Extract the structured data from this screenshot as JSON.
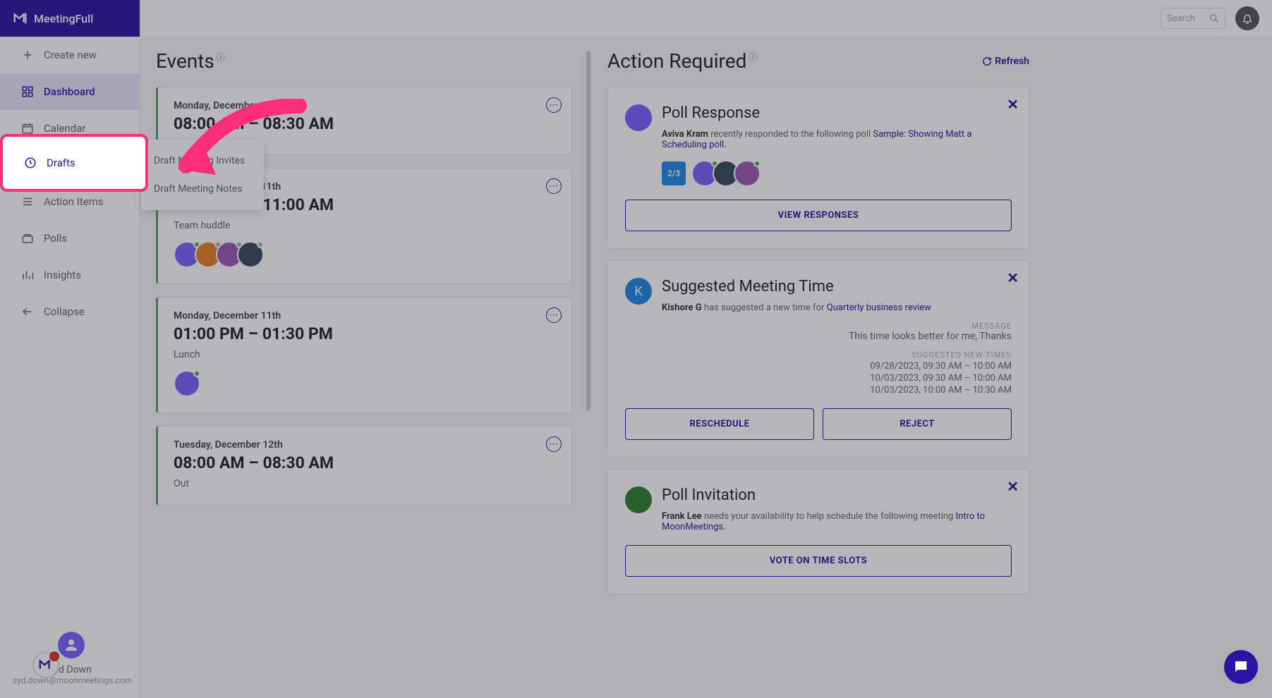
{
  "brand": "MeetingFull",
  "sidebar": {
    "items": [
      {
        "icon": "plus",
        "label": "Create new"
      },
      {
        "icon": "grid",
        "label": "Dashboard"
      },
      {
        "icon": "calendar",
        "label": "Calendar"
      },
      {
        "icon": "clock",
        "label": "Drafts"
      },
      {
        "icon": "list",
        "label": "Action Items"
      },
      {
        "icon": "poll",
        "label": "Polls"
      },
      {
        "icon": "bar",
        "label": "Insights"
      },
      {
        "icon": "arrow-left",
        "label": "Collapse"
      }
    ]
  },
  "user": {
    "name": "Syd Down",
    "email": "syd.down@moonmeetings.com"
  },
  "search_placeholder": "Search",
  "events": {
    "title": "Events",
    "items": [
      {
        "date": "Monday, December 11th",
        "time": "08:00 AM – 08:30 AM",
        "title": "",
        "avatars": []
      },
      {
        "date": "Monday, December 11th",
        "time": "10:30 AM – 11:00 AM",
        "title": "Team huddle",
        "avatars": [
          "a",
          "b",
          "c",
          "d"
        ]
      },
      {
        "date": "Monday, December 11th",
        "time": "01:00 PM – 01:30 PM",
        "title": "Lunch",
        "avatars": [
          "a"
        ]
      },
      {
        "date": "Tuesday, December 12th",
        "time": "08:00 AM – 08:30 AM",
        "title": "Out",
        "avatars": []
      }
    ]
  },
  "popup": {
    "items": [
      "Draft Meeting Invites",
      "Draft Meeting Notes"
    ]
  },
  "action": {
    "title": "Action Required",
    "refresh": "Refresh",
    "cards": {
      "poll_response": {
        "title": "Poll Response",
        "actor": "Aviva Kram",
        "text": "recently responded to the following poll",
        "link": "Sample: Showing Matt a Scheduling poll",
        "badge": "2/3",
        "button": "VIEW RESPONSES"
      },
      "suggested": {
        "title": "Suggested Meeting Time",
        "actor": "Kishore G",
        "text": "has suggested a new time for",
        "link": "Quarterly business review",
        "avatar_letter": "K",
        "message_label": "MESSAGE",
        "message": "This time looks better for me, Thanks",
        "times_label": "SUGGESTED NEW TIMES",
        "times": [
          "09/28/2023, 09:30 AM – 10:00 AM",
          "10/03/2023, 09:30 AM – 10:00 AM",
          "10/03/2023, 10:00 AM – 10:30 AM"
        ],
        "btn1": "RESCHEDULE",
        "btn2": "REJECT"
      },
      "invitation": {
        "title": "Poll Invitation",
        "actor": "Frank Lee",
        "text": "needs your availability to help schedule the following meeting",
        "link": "Intro to MoonMeetings",
        "button": "VOTE ON TIME SLOTS"
      }
    }
  },
  "highlight_label": "Drafts"
}
